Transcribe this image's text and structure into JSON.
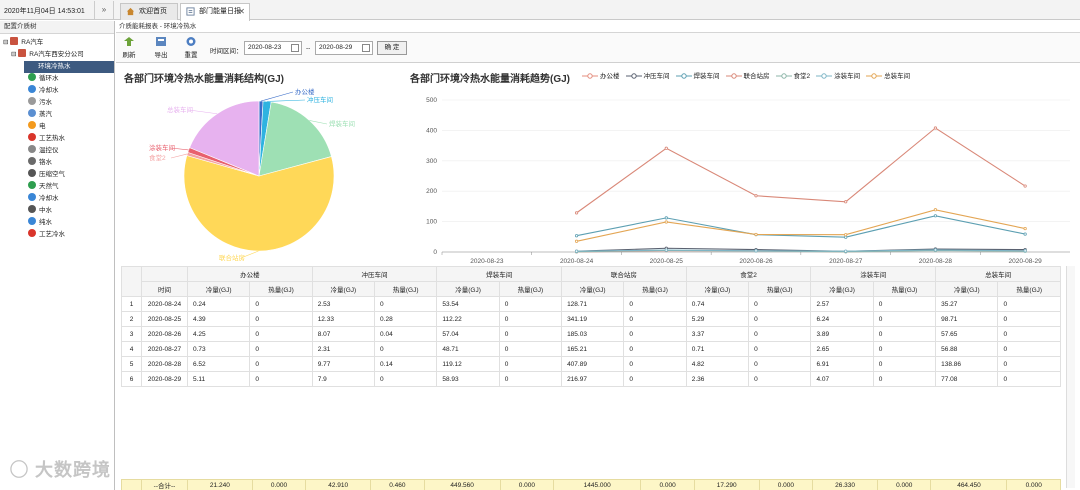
{
  "topbar": {
    "datetime": "2020年11月04日 14:53:01",
    "collapse_icon": "»"
  },
  "tabs": [
    {
      "label": "欢迎首页",
      "icon": "home-icon"
    },
    {
      "label": "部门能量日报",
      "icon": "report-icon",
      "close": "✕"
    }
  ],
  "sidebar": {
    "header": "配置介质树",
    "items": [
      {
        "label": "RA汽车",
        "prefix": "⊟"
      },
      {
        "label": "RA汽车西安分公司",
        "prefix": "⊟"
      },
      {
        "label": "环境冷热水"
      },
      {
        "label": "循环水",
        "color": "#2e9e4f"
      },
      {
        "label": "冷却水",
        "color": "#3a86d6"
      },
      {
        "label": "污水",
        "color": "#7b7b7b"
      },
      {
        "label": "蒸汽",
        "color": "#5b8fd1"
      },
      {
        "label": "电",
        "color": "#f39a1e"
      },
      {
        "label": "工艺热水",
        "color": "#d9352b"
      },
      {
        "label": "温控仪",
        "color": "#888888"
      },
      {
        "label": "铬水",
        "color": "#6a6a6a"
      },
      {
        "label": "压缩空气",
        "color": "#555555"
      },
      {
        "label": "天然气",
        "color": "#2e9e4f"
      },
      {
        "label": "冷却水",
        "color": "#3a86d6"
      },
      {
        "label": "中水",
        "color": "#555555"
      },
      {
        "label": "纯水",
        "color": "#3a86d6"
      },
      {
        "label": "工艺冷水",
        "color": "#d9352b"
      }
    ]
  },
  "breadcrumb": "介质能耗报表 - 环境冷热水",
  "toolbar": {
    "refresh": "刷新",
    "export": "导出",
    "reset": "重置",
    "range_label": "时间区间：",
    "start": "2020-08-23",
    "sep": "--",
    "end": "2020-08-29",
    "confirm": "确 定"
  },
  "pie": {
    "title": "各部门环境冷热水能量消耗结构(GJ)",
    "series": [
      {
        "name": "办公楼",
        "value": 21.24,
        "color": "#3b6ec9"
      },
      {
        "name": "冲压车间",
        "value": 42.91,
        "color": "#2fb3e0"
      },
      {
        "name": "焊装车间",
        "value": 449.56,
        "color": "#9ee0b4"
      },
      {
        "name": "联合站房",
        "value": 1445.0,
        "color": "#ffd858"
      },
      {
        "name": "食堂2",
        "value": 17.29,
        "color": "#f4a3a3"
      },
      {
        "name": "涂装车间",
        "value": 26.33,
        "color": "#e8606e"
      },
      {
        "name": "总装车间",
        "value": 464.45,
        "color": "#e7b2ef"
      }
    ]
  },
  "chart_data": {
    "type": "line",
    "title": "各部门环境冷热水能量消耗趋势(GJ)",
    "x": [
      "2020-08-23",
      "2020-08-24",
      "2020-08-25",
      "2020-08-26",
      "2020-08-27",
      "2020-08-28",
      "2020-08-29"
    ],
    "ylim": [
      0,
      500
    ],
    "yticks": [
      0,
      100,
      200,
      300,
      400,
      500
    ],
    "series": [
      {
        "name": "办公楼",
        "color": "#e48d7e",
        "values": [
          null,
          0.24,
          4.39,
          4.25,
          0.73,
          6.52,
          5.11
        ]
      },
      {
        "name": "冲压车间",
        "color": "#5a6170",
        "values": [
          null,
          2.53,
          12.33,
          8.07,
          2.31,
          9.77,
          7.9
        ]
      },
      {
        "name": "焊装车间",
        "color": "#5c9fb2",
        "values": [
          null,
          53.54,
          112.22,
          57.04,
          48.71,
          119.12,
          58.93
        ]
      },
      {
        "name": "联合站房",
        "color": "#d98878",
        "values": [
          null,
          128.71,
          341.19,
          185.03,
          165.21,
          407.89,
          216.97
        ]
      },
      {
        "name": "食堂2",
        "color": "#8cb5a8",
        "values": [
          null,
          0.74,
          5.29,
          3.37,
          0.71,
          4.82,
          2.36
        ]
      },
      {
        "name": "涂装车间",
        "color": "#7db5c6",
        "values": [
          null,
          2.57,
          6.24,
          3.89,
          2.65,
          6.91,
          4.07
        ]
      },
      {
        "name": "总装车间",
        "color": "#e3a553",
        "values": [
          null,
          35.27,
          98.71,
          57.65,
          56.88,
          138.86,
          77.08
        ]
      }
    ]
  },
  "table": {
    "time_header": "时间",
    "sub_headers": [
      "冷量(GJ)",
      "热量(GJ)"
    ],
    "rows": [
      {
        "n": "1",
        "date": "2020-08-24",
        "v": [
          "0.24",
          "0",
          "2.53",
          "0",
          "53.54",
          "0",
          "128.71",
          "0",
          "0.74",
          "0",
          "2.57",
          "0",
          "35.27",
          "0"
        ]
      },
      {
        "n": "2",
        "date": "2020-08-25",
        "v": [
          "4.39",
          "0",
          "12.33",
          "0.28",
          "112.22",
          "0",
          "341.19",
          "0",
          "5.29",
          "0",
          "6.24",
          "0",
          "98.71",
          "0"
        ]
      },
      {
        "n": "3",
        "date": "2020-08-26",
        "v": [
          "4.25",
          "0",
          "8.07",
          "0.04",
          "57.04",
          "0",
          "185.03",
          "0",
          "3.37",
          "0",
          "3.89",
          "0",
          "57.65",
          "0"
        ]
      },
      {
        "n": "4",
        "date": "2020-08-27",
        "v": [
          "0.73",
          "0",
          "2.31",
          "0",
          "48.71",
          "0",
          "165.21",
          "0",
          "0.71",
          "0",
          "2.65",
          "0",
          "56.88",
          "0"
        ]
      },
      {
        "n": "5",
        "date": "2020-08-28",
        "v": [
          "6.52",
          "0",
          "9.77",
          "0.14",
          "119.12",
          "0",
          "407.89",
          "0",
          "4.82",
          "0",
          "6.91",
          "0",
          "138.86",
          "0"
        ]
      },
      {
        "n": "6",
        "date": "2020-08-29",
        "v": [
          "5.11",
          "0",
          "7.9",
          "0",
          "58.93",
          "0",
          "216.97",
          "0",
          "2.36",
          "0",
          "4.07",
          "0",
          "77.08",
          "0"
        ]
      }
    ],
    "totals_label": "--合计--",
    "totals": [
      "21.240",
      "0.000",
      "42.910",
      "0.460",
      "449.560",
      "0.000",
      "1445.000",
      "0.000",
      "17.290",
      "0.000",
      "26.330",
      "0.000",
      "464.450",
      "0.000"
    ]
  },
  "watermark": "大数跨境"
}
